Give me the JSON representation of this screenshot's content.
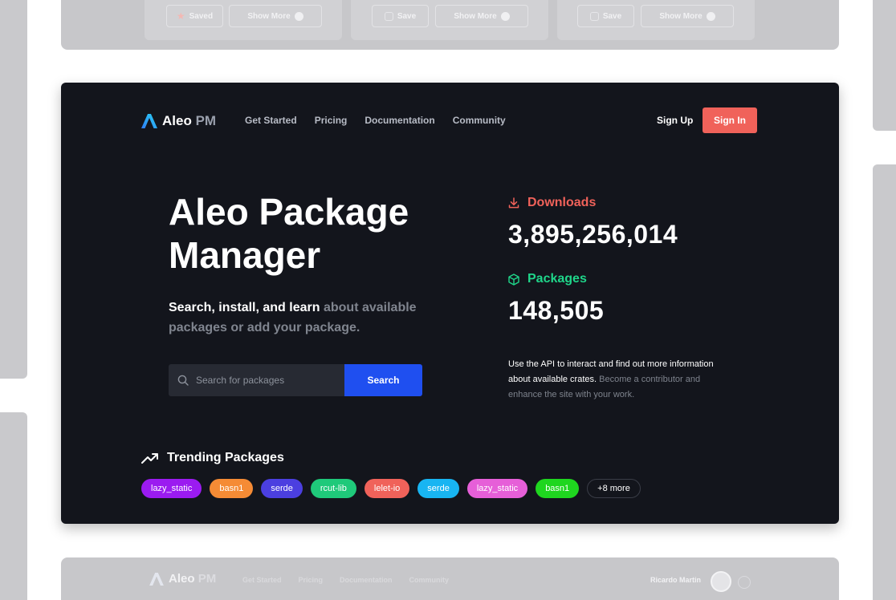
{
  "top_cards": [
    {
      "save_label": "Saved",
      "show_more_label": "Show More",
      "saved": true
    },
    {
      "save_label": "Save",
      "show_more_label": "Show More",
      "saved": false
    },
    {
      "save_label": "Save",
      "show_more_label": "Show More",
      "saved": false
    }
  ],
  "header": {
    "logo_main": "Aleo",
    "logo_suffix": "PM",
    "nav": [
      "Get Started",
      "Pricing",
      "Documentation",
      "Community"
    ],
    "signup_label": "Sign Up",
    "signin_label": "Sign In"
  },
  "hero": {
    "title_line1": "Aleo Package",
    "title_line2": "Manager",
    "subtitle_strong": "Search, install, and learn",
    "subtitle_muted": "about available packages or add your package.",
    "search_placeholder": "Search for packages",
    "search_button": "Search"
  },
  "stats": {
    "downloads_label": "Downloads",
    "downloads_value": "3,895,256,014",
    "packages_label": "Packages",
    "packages_value": "148,505",
    "api_text_strong": "Use the API to interact and find out more information about available crates.",
    "api_text_muted": "Become a contributor and enhance the site with your work."
  },
  "trending": {
    "title": "Trending Packages",
    "tags": [
      {
        "label": "lazy_static",
        "color": "#9b1bf0"
      },
      {
        "label": "basn1",
        "color": "#f58b35"
      },
      {
        "label": "serde",
        "color": "#4b3fe0"
      },
      {
        "label": "rcut-lib",
        "color": "#1fc97a"
      },
      {
        "label": "lelet-io",
        "color": "#f0625a"
      },
      {
        "label": "serde",
        "color": "#18b5f2"
      },
      {
        "label": "lazy_static",
        "color": "#e65fd8"
      },
      {
        "label": "basn1",
        "color": "#1fd61f"
      }
    ],
    "more_label": "+8 more"
  },
  "bottom_header": {
    "logo_main": "Aleo",
    "logo_suffix": "PM",
    "nav": [
      "Get Started",
      "Pricing",
      "Documentation",
      "Community"
    ],
    "user_name": "Ricardo Martin"
  },
  "colors": {
    "accent_red": "#f0625a",
    "accent_green": "#1fd68a",
    "search_blue": "#1f4ff0",
    "card_bg": "#13151c"
  }
}
